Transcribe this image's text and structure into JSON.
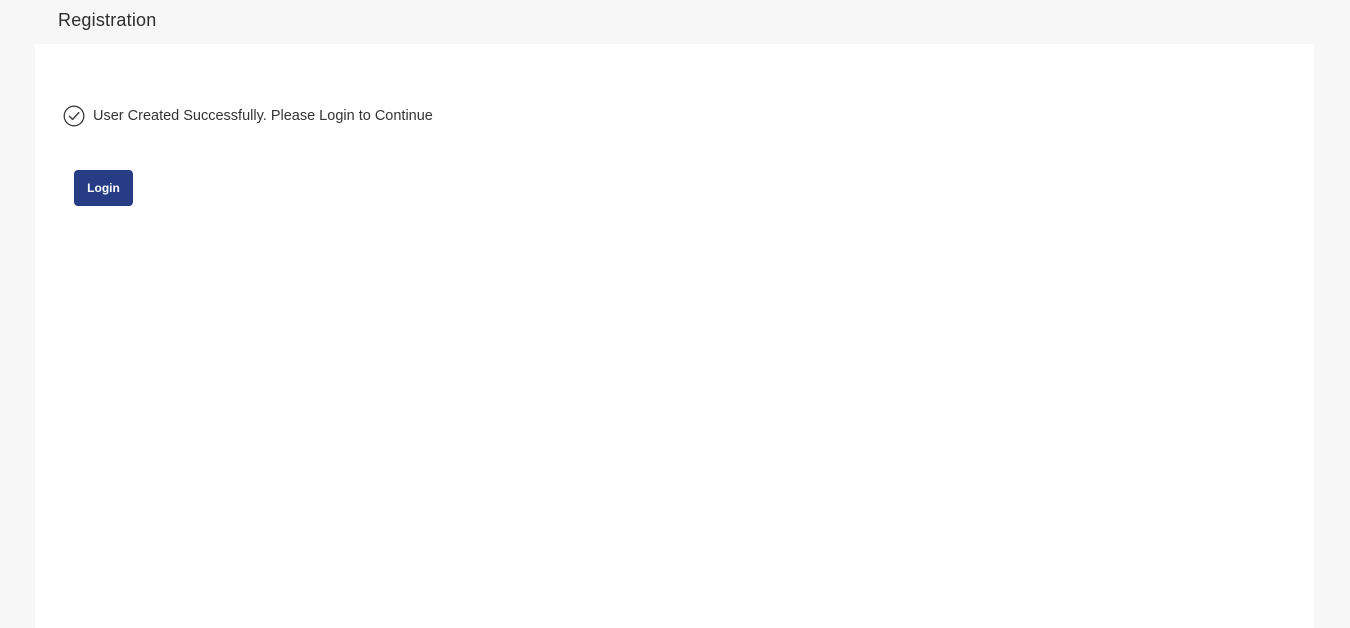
{
  "header": {
    "title": "Registration"
  },
  "message": {
    "icon": "check-circle-icon",
    "text": "User Created Successfully. Please Login to Continue"
  },
  "actions": {
    "login_label": "Login"
  },
  "colors": {
    "primary_button": "#263d85",
    "page_background": "#f7f7f7",
    "card_background": "#ffffff"
  }
}
